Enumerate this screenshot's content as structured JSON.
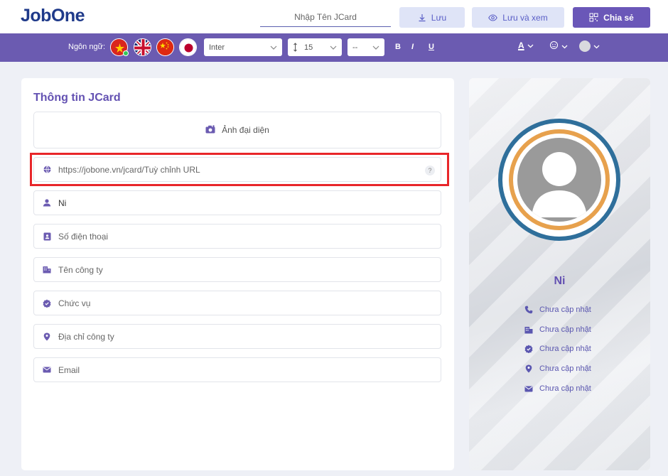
{
  "header": {
    "logo": "JobOne",
    "name_placeholder": "Nhập Tên JCard",
    "save_label": "Lưu",
    "save_view_label": "Lưu và xem",
    "share_label": "Chia sẻ"
  },
  "toolbar": {
    "language_label": "Ngôn ngữ:",
    "languages": [
      "vi",
      "en",
      "zh",
      "ja"
    ],
    "font": "Inter",
    "font_size": "15",
    "line_height": "--",
    "bold": "B",
    "italic": "I",
    "underline": "U",
    "text_color_glyph": "A"
  },
  "form": {
    "title": "Thông tin JCard",
    "avatar_label": "Ảnh đại diện",
    "url_placeholder": "https://jobone.vn/jcard/Tuỳ chỉnh URL",
    "help_glyph": "?",
    "name_value": "Ni",
    "phone_placeholder": "Số điện thoại",
    "company_placeholder": "Tên công ty",
    "position_placeholder": "Chức vụ",
    "address_placeholder": "Địa chỉ công ty",
    "email_placeholder": "Email"
  },
  "preview": {
    "name": "Ni",
    "phone": "Chưa cập nhật",
    "company": "Chưa cập nhật",
    "position": "Chưa cập nhật",
    "address": "Chưa cập nhật",
    "email": "Chưa cập nhật"
  },
  "colors": {
    "primary": "#6b5bb1",
    "highlight": "#e8262a",
    "ring_outer": "#2f6f9b",
    "ring_inner": "#e7a14d"
  }
}
